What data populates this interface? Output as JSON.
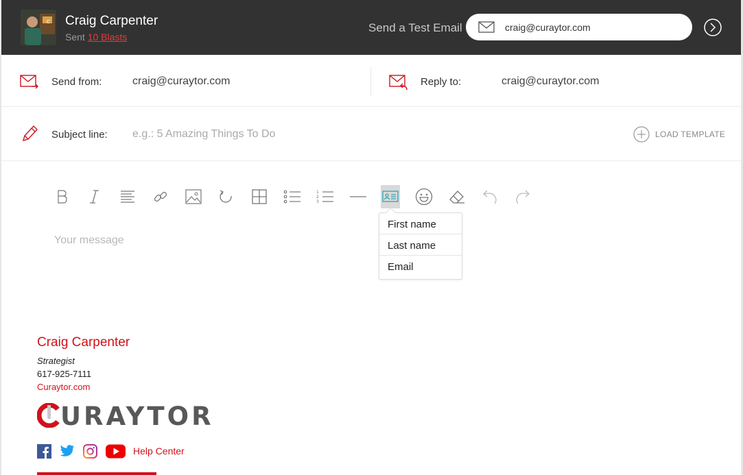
{
  "header": {
    "user_name": "Craig Carpenter",
    "sent_prefix": "Sent",
    "sent_link": "10 Blasts",
    "test_label": "Send a Test Email",
    "test_email_value": "craig@curaytor.com"
  },
  "fields": {
    "send_from_label": "Send from:",
    "send_from_value": "craig@curaytor.com",
    "reply_to_label": "Reply to:",
    "reply_to_value": "craig@curaytor.com",
    "subject_label": "Subject line:",
    "subject_placeholder": "e.g.: 5 Amazing Things To Do",
    "load_template": "LOAD TEMPLATE"
  },
  "toolbar": {
    "buttons": [
      "bold-icon",
      "italic-icon",
      "align-icon",
      "link-icon",
      "image-icon",
      "redo-circle-icon",
      "table-icon",
      "bullet-list-icon",
      "numbered-list-icon",
      "horizontal-rule-icon",
      "merge-tag-icon",
      "emoji-icon",
      "eraser-icon",
      "undo-icon",
      "redo-icon"
    ],
    "active": "merge-tag-icon"
  },
  "merge_menu": {
    "items": [
      "First name",
      "Last name",
      "Email"
    ]
  },
  "editor": {
    "placeholder": "Your message"
  },
  "signature": {
    "name": "Craig Carpenter",
    "title": "Strategist",
    "phone": "617-925-7111",
    "website": "Curaytor.com",
    "logo_text": "URAYTOR",
    "help": "Help Center"
  },
  "colors": {
    "header_bg": "#323232",
    "brand_red": "#d0121b",
    "accent_teal": "#2aa6b8"
  }
}
